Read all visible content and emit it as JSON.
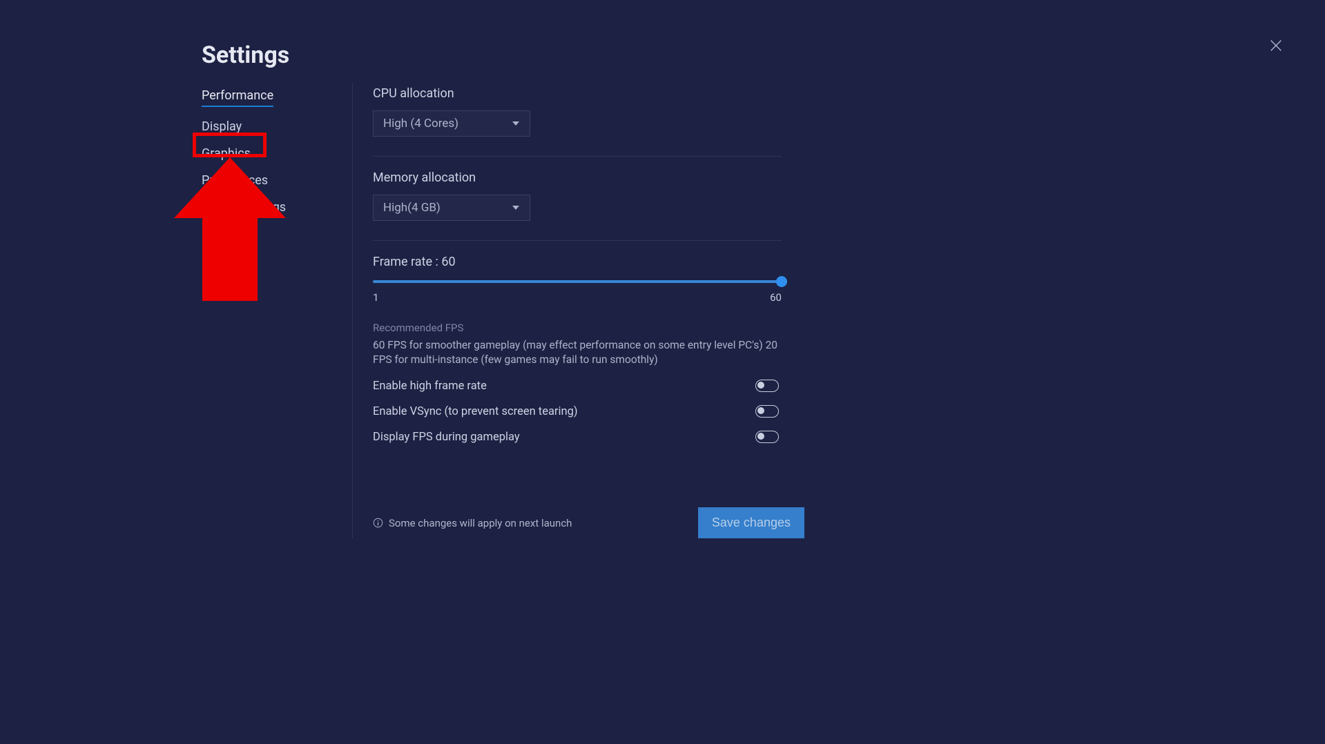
{
  "header": {
    "title": "Settings"
  },
  "sidebar": {
    "items": [
      {
        "label": "Performance",
        "active": true
      },
      {
        "label": "Display",
        "active": false
      },
      {
        "label": "Graphics",
        "active": false
      },
      {
        "label": "Preferences",
        "active": false
      },
      {
        "label": "Device settings",
        "active": false
      }
    ]
  },
  "cpu": {
    "label": "CPU allocation",
    "value": "High (4 Cores)"
  },
  "memory": {
    "label": "Memory allocation",
    "value": "High(4 GB)"
  },
  "frame_rate": {
    "label_prefix": "Frame rate : ",
    "value": "60",
    "min": "1",
    "max": "60"
  },
  "fps_block": {
    "heading": "Recommended FPS",
    "desc": "60 FPS for smoother gameplay (may effect performance on some entry level PC's) 20 FPS for multi-instance (few games may fail to run smoothly)"
  },
  "toggles": {
    "high_fps": {
      "label": "Enable high frame rate",
      "on": false
    },
    "vsync": {
      "label": "Enable VSync (to prevent screen tearing)",
      "on": false
    },
    "show_fps": {
      "label": "Display FPS during gameplay",
      "on": false
    }
  },
  "footer": {
    "notice": "Some changes will apply on next launch",
    "save_label": "Save changes"
  },
  "annotation": {
    "target": "Graphics"
  }
}
